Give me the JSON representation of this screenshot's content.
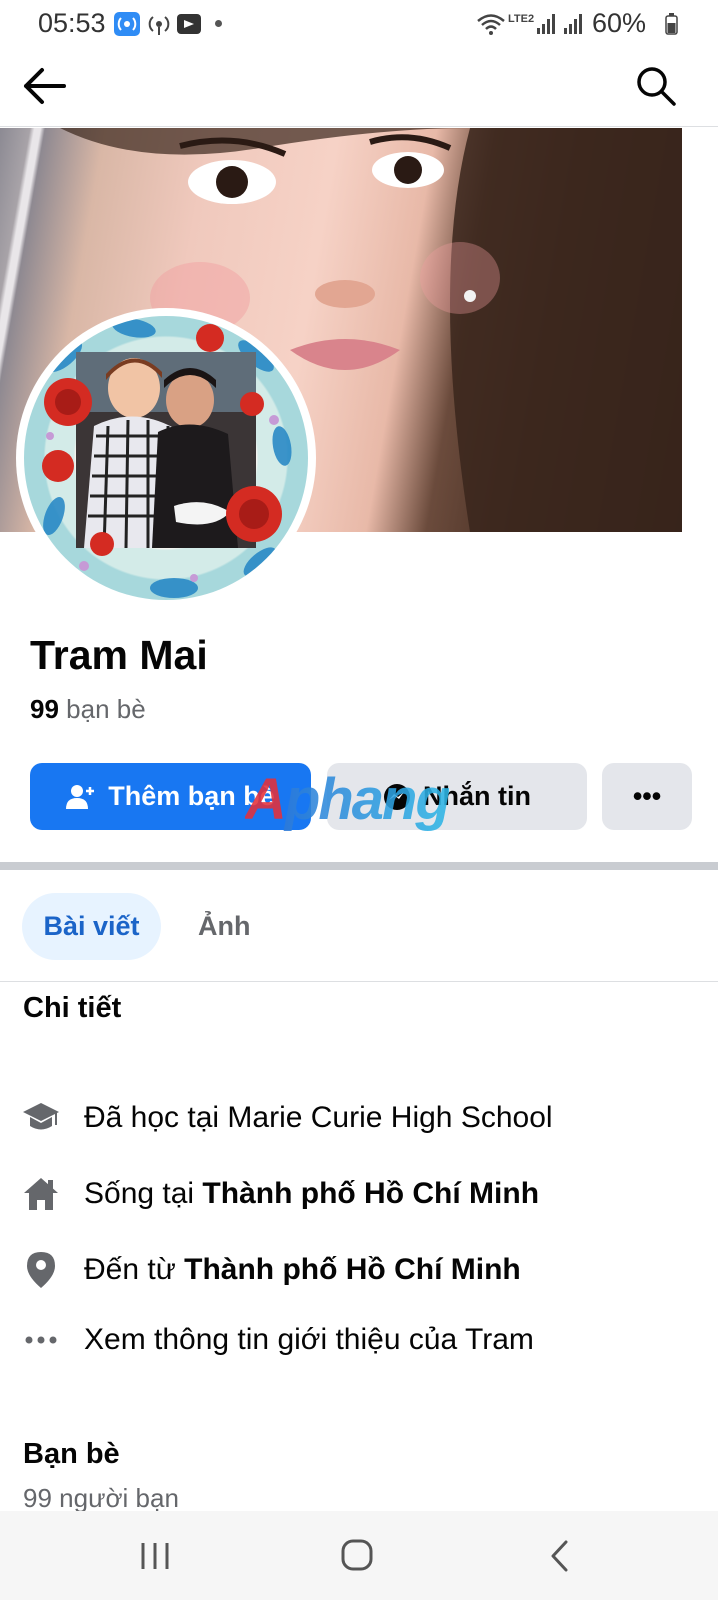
{
  "status_bar": {
    "time": "05:53",
    "battery": "60%",
    "network_label": "LTE2"
  },
  "nav": {
    "back_icon": "arrow-left-icon",
    "search_icon": "search-icon"
  },
  "profile": {
    "name": "Tram Mai",
    "friends_count": "99",
    "friends_label": "bạn bè"
  },
  "actions": {
    "add_friend": "Thêm bạn bè",
    "message": "Nhắn tin",
    "more": "•••"
  },
  "watermark": "Aphang",
  "tabs": [
    {
      "label": "Bài viết",
      "active": true
    },
    {
      "label": "Ảnh",
      "active": false
    }
  ],
  "details": {
    "title": "Chi tiết",
    "studied": {
      "prefix": "Đã học tại ",
      "value": "Marie Curie High School"
    },
    "lives": {
      "prefix": "Sống tại ",
      "value": "Thành phố Hồ Chí Minh"
    },
    "from": {
      "prefix": "Đến từ ",
      "value": "Thành phố Hồ Chí Minh"
    },
    "see_about": "Xem thông tin giới thiệu của Tram"
  },
  "friends_section": {
    "title": "Bạn bè",
    "subtitle": "99 người bạn"
  },
  "colors": {
    "primary": "#1877f2",
    "secondary_button": "#e4e6eb",
    "active_tab_bg": "#e7f3ff",
    "active_tab_text": "#1b64c8"
  }
}
